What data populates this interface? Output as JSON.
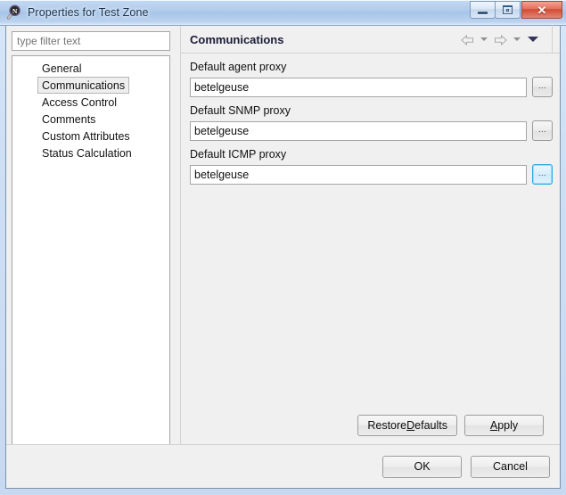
{
  "window": {
    "title": "Properties for Test Zone",
    "icon": "netxms-magnifier-icon",
    "controls": {
      "minimize_label": "Minimize",
      "restore_label": "Restore",
      "close_label": "✕"
    }
  },
  "sidebar": {
    "filter": {
      "placeholder": "type filter text",
      "value": ""
    },
    "items": [
      {
        "label": "General",
        "selected": false
      },
      {
        "label": "Communications",
        "selected": true
      },
      {
        "label": "Access Control",
        "selected": false
      },
      {
        "label": "Comments",
        "selected": false
      },
      {
        "label": "Custom Attributes",
        "selected": false
      },
      {
        "label": "Status Calculation",
        "selected": false
      }
    ]
  },
  "page": {
    "title": "Communications",
    "nav": {
      "back_icon": "arrow-left-icon",
      "back_menu_icon": "chevron-down-icon",
      "forward_icon": "arrow-right-icon",
      "forward_menu_icon": "chevron-down-icon",
      "view_menu_icon": "chevron-down-icon"
    },
    "fields": [
      {
        "label": "Default agent proxy",
        "value": "betelgeuse",
        "browse_label": "...",
        "focused": false
      },
      {
        "label": "Default SNMP proxy",
        "value": "betelgeuse",
        "browse_label": "...",
        "focused": false
      },
      {
        "label": "Default ICMP proxy",
        "value": "betelgeuse",
        "browse_label": "...",
        "focused": true
      }
    ],
    "buttons": {
      "restore_defaults": "Restore ",
      "restore_defaults_mnemonic": "D",
      "restore_defaults_tail": "efaults",
      "apply_mnemonic": "A",
      "apply_tail": "pply"
    }
  },
  "dialog": {
    "ok_label": "OK",
    "cancel_label": "Cancel"
  },
  "colors": {
    "titlebar_top": "#c2d9f2",
    "titlebar_bottom": "#dce9f8",
    "frame": "#c6d9f1",
    "close_button": "#cf4a33",
    "focus_border": "#2aa8e0",
    "panel_bg": "#f0f0f0",
    "field_bg": "#ffffff",
    "title_color": "#1b1b38"
  }
}
